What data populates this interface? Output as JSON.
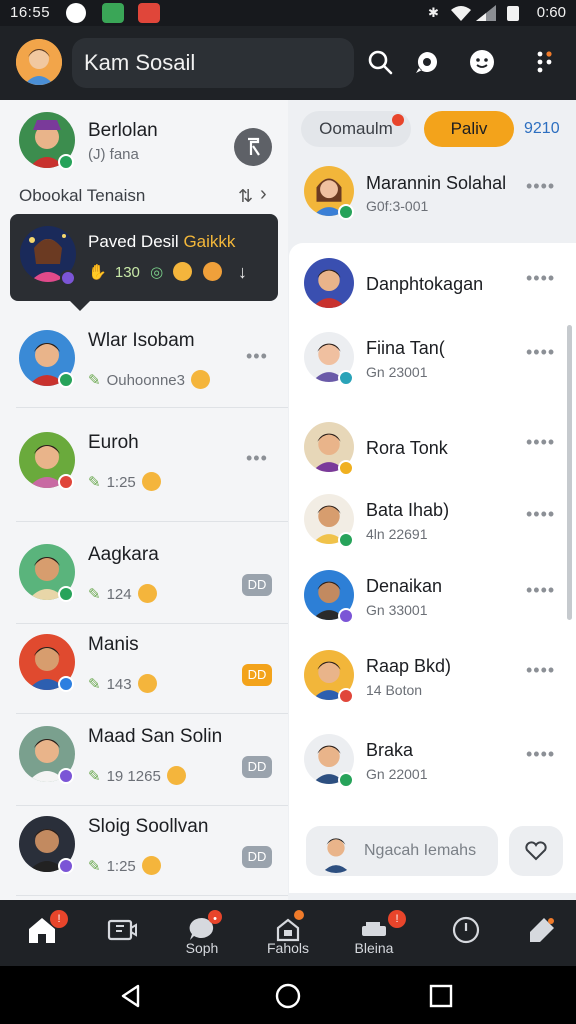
{
  "status_bar": {
    "time": "16:55",
    "right_time": "0:60"
  },
  "header": {
    "title": "Kam Sosail"
  },
  "left_panel": {
    "top_contact": {
      "name": "Berlolan",
      "sub": "(J) fana"
    },
    "section_label": "Obookal Tenaisn",
    "popup": {
      "title": "Paved Desil",
      "title_accent": "Gaikkk",
      "count": "130"
    },
    "contacts": [
      {
        "name": "Wlar Isobam",
        "sub": "Ouhoonne3",
        "badge": "",
        "presence": "#27a35a",
        "skin": "#e9b48a",
        "bg": "#3a8ad6",
        "shirt": "#c8322e"
      },
      {
        "name": "Euroh",
        "sub": "1:25",
        "badge": "",
        "presence": "#e0463a",
        "skin": "#e9b48a",
        "bg": "#6aaa3c",
        "shirt": "#c86aa3"
      },
      {
        "name": "Aagkara",
        "sub": "124",
        "badge": "DD",
        "presence": "#27a35a",
        "skin": "#d79d6e",
        "bg": "#5ab47c",
        "shirt": "#e8d6a8"
      },
      {
        "name": "Manis",
        "sub": "143",
        "badge": "DD",
        "presence": "#2d7fe0",
        "skin": "#d79d6e",
        "bg": "#e04a2f",
        "shirt": "#2d5fb0"
      },
      {
        "name": "Maad San Solin",
        "sub": "19 1265",
        "badge": "DD",
        "presence": "#7b55d6",
        "skin": "#e9b48a",
        "bg": "#7aa08e",
        "shirt": "#f4f4f4"
      },
      {
        "name": "Sloig Soollvan",
        "sub": "1:25",
        "badge": "DD",
        "presence": "#7b55d6",
        "skin": "#c28a60",
        "bg": "#2a2f3a",
        "shirt": "#222"
      }
    ]
  },
  "right_panel": {
    "chip_primary": "Oomaulm",
    "chip_accent": "Paliv",
    "chip_tag": "9210",
    "top_contact": {
      "name": "Marannin Solahal",
      "sub": "G0f:3-001"
    },
    "contacts": [
      {
        "name": "Danphtokagan",
        "sub": "",
        "presence": ""
      },
      {
        "name": "Fiina Tan(",
        "sub": "Gn 23001",
        "presence": "#2aa3b8"
      },
      {
        "name": "Rora Tonk",
        "sub": "",
        "presence": "#f0b020"
      },
      {
        "name": "Bata Ihab)",
        "sub": "4ln 22691",
        "presence": "#27a35a"
      },
      {
        "name": "Denaikan",
        "sub": "Gn 33001",
        "presence": "#7b55d6"
      },
      {
        "name": "Raap Bkd)",
        "sub": "14 Boton",
        "presence": "#e0463a"
      },
      {
        "name": "Braka",
        "sub": "Gn 22001",
        "presence": "#27a35a"
      }
    ],
    "composer_placeholder": "Ngacah Iemahs"
  },
  "bottom_nav": {
    "items": [
      {
        "label": "",
        "icon": "home-icon"
      },
      {
        "label": "",
        "icon": "video-icon"
      },
      {
        "label": "Soph",
        "icon": "chat-bubble-icon"
      },
      {
        "label": "Fahols",
        "icon": "home-outline-icon"
      },
      {
        "label": "Bleina",
        "icon": "inbox-icon"
      },
      {
        "label": "",
        "icon": "clock-icon"
      },
      {
        "label": "",
        "icon": "edit-icon"
      }
    ]
  }
}
